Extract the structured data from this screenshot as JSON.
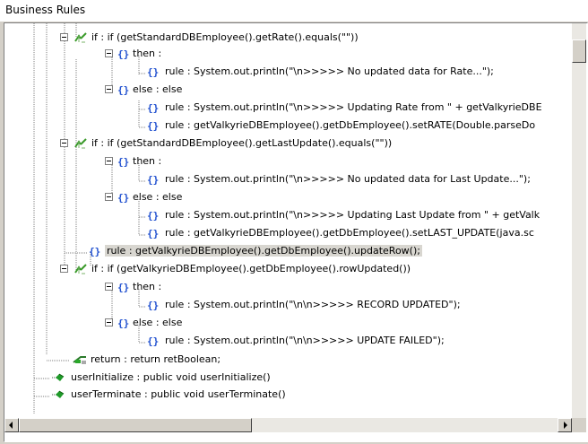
{
  "panel": {
    "title": "Business Rules"
  },
  "tree": {
    "rows": [
      {
        "label": "if : if (getStandardDBEmployee().getRate().equals(\"\"))",
        "icon": "if-icon",
        "expanded": true
      },
      {
        "label": "then :",
        "icon": "block-icon",
        "expanded": true
      },
      {
        "label": "rule : System.out.println(\"\\n>>>>> No updated data for Rate...\");",
        "icon": "block-icon"
      },
      {
        "label": "else : else",
        "icon": "block-icon",
        "expanded": true
      },
      {
        "label": "rule : System.out.println(\"\\n>>>>> Updating Rate from \" + getValkyrieDBE",
        "icon": "block-icon"
      },
      {
        "label": "rule : getValkyrieDBEmployee().getDbEmployee().setRATE(Double.parseDo",
        "icon": "block-icon"
      },
      {
        "label": "if : if (getStandardDBEmployee().getLastUpdate().equals(\"\"))",
        "icon": "if-icon",
        "expanded": true
      },
      {
        "label": "then :",
        "icon": "block-icon",
        "expanded": true
      },
      {
        "label": "rule : System.out.println(\"\\n>>>>> No updated data for Last Update...\");",
        "icon": "block-icon"
      },
      {
        "label": "else : else",
        "icon": "block-icon",
        "expanded": true
      },
      {
        "label": "rule : System.out.println(\"\\n>>>>> Updating Last Update from \" + getValk",
        "icon": "block-icon"
      },
      {
        "label": "rule : getValkyrieDBEmployee().getDbEmployee().setLAST_UPDATE(java.sc",
        "icon": "block-icon"
      },
      {
        "label": "rule : getValkyrieDBEmployee().getDbEmployee().updateRow();",
        "icon": "block-icon",
        "selected": true
      },
      {
        "label": "if : if (getValkyrieDBEmployee().getDbEmployee().rowUpdated())",
        "icon": "if-icon",
        "expanded": true
      },
      {
        "label": "then :",
        "icon": "block-icon",
        "expanded": true
      },
      {
        "label": "rule : System.out.println(\"\\n\\n>>>>> RECORD UPDATED\");",
        "icon": "block-icon"
      },
      {
        "label": "else : else",
        "icon": "block-icon",
        "expanded": true
      },
      {
        "label": "rule : System.out.println(\"\\n\\n>>>>> UPDATE FAILED\");",
        "icon": "block-icon"
      },
      {
        "label": "return : return retBoolean;",
        "icon": "return-icon"
      },
      {
        "label": "userInitialize : public void userInitialize()",
        "icon": "method-icon"
      },
      {
        "label": "userTerminate : public void userTerminate()",
        "icon": "method-icon"
      }
    ]
  },
  "colors": {
    "selection": "#d8d6d0",
    "if_icon": "#3a9a2a",
    "block_icon": "#1f4fcf",
    "method_icon": "#1f9a2a"
  }
}
